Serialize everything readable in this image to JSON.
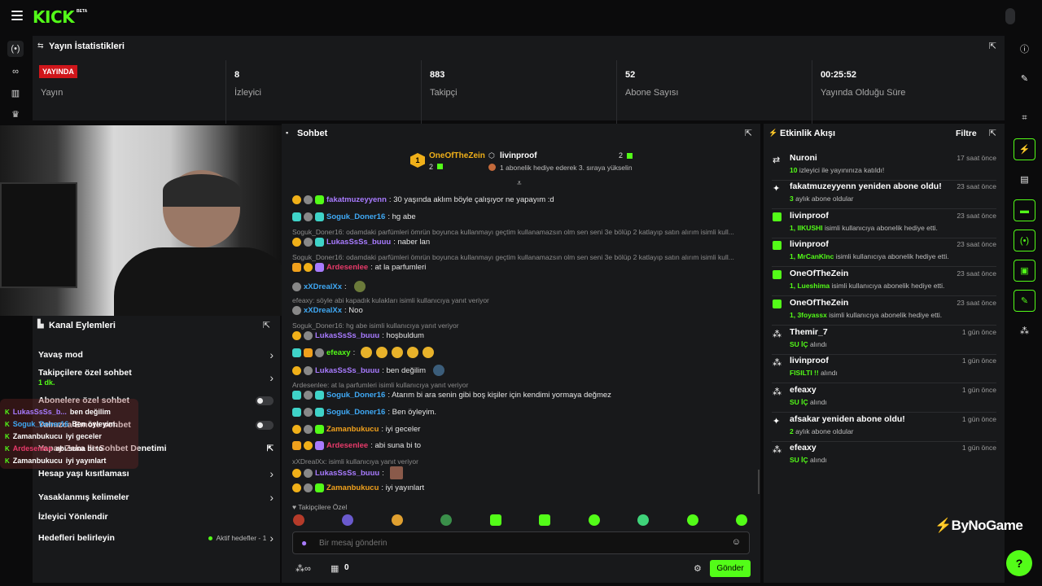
{
  "app": {
    "logo": "KICK",
    "beta": "BETA"
  },
  "colors": {
    "accent": "#53fc18",
    "live": "#d0161b",
    "panel": "#18191b"
  },
  "stats": {
    "title": "Yayın İstatistikleri",
    "live_badge": "YAYINDA",
    "cells": [
      {
        "value": "",
        "label": "Yayın"
      },
      {
        "value": "8",
        "label": "İzleyici"
      },
      {
        "value": "883",
        "label": "Takipçi"
      },
      {
        "value": "52",
        "label": "Abone Sayısı"
      },
      {
        "value": "00:25:52",
        "label": "Yayında Olduğu Süre"
      }
    ]
  },
  "channel": {
    "title": "Kanal Eylemleri",
    "items": [
      {
        "label": "Yavaş mod",
        "sub": ""
      },
      {
        "label": "Takipçilere özel sohbet",
        "sub": "1 dk."
      },
      {
        "label": "Abonelere özel sohbet",
        "sub": ""
      },
      {
        "label": "Yalnızca Emote sohbet",
        "sub": ""
      },
      {
        "label": "Yapay Zeka ile Sohbet Denetimi",
        "sub": ""
      },
      {
        "label": "Hesap yaşı kısıtlaması",
        "sub": ""
      },
      {
        "label": "Yasaklanmış kelimeler",
        "sub": ""
      },
      {
        "label": "İzleyici Yönlendir",
        "sub": ""
      },
      {
        "label": "Hedefleri belirleyin",
        "sub": "Aktif hedefler - 1"
      }
    ]
  },
  "overlay_chat": [
    {
      "user": "LukasSsSs_b...",
      "text": "ben değilim"
    },
    {
      "user": "Soguk_Doner16",
      "text": "Ben öyleyim."
    },
    {
      "user": "Zamanbukucu",
      "text": "iyi geceler"
    },
    {
      "user": "Ardesenlee",
      "text": "abi suna bi to"
    },
    {
      "user": "Zamanbukucu",
      "text": "iyi yayınlart"
    }
  ],
  "chat": {
    "title": "Sohbet",
    "pinned": {
      "user1": "OneOfTheZein",
      "user1_count": "2",
      "user2": "livinproof",
      "user2_count": "2",
      "user2_msg": "1 abonelik hediye ederek 3. sıraya yükselin"
    },
    "messages": [
      {
        "user": "fakatmuzeyyenn",
        "color": "#a87bff",
        "text": ": 30 yaşında aklım böyle çalışıyor ne yapayım :d",
        "reply": ""
      },
      {
        "user": "Soguk_Doner16",
        "color": "#3fa9f5",
        "text": ": hg abe",
        "reply": ""
      },
      {
        "user": "LukasSsSs_buuu",
        "color": "#a87bff",
        "text": ": naber lan",
        "reply": "Soguk_Doner16: odamdaki parfümleri ömrün boyunca kullanmayı geçtim kullanamazsın olm sen seni 3e bölüp 2 katlayıp satın alırım isimli kull..."
      },
      {
        "user": "Ardesenlee",
        "color": "#e83a6a",
        "text": ": at la parfumleri",
        "reply": "Soguk_Doner16: odamdaki parfümleri ömrün boyunca kullanmayı geçtim kullanamazsın olm sen seni 3e bölüp 2 katlayıp satın alırım isimli kull..."
      },
      {
        "user": "xXDrealXx",
        "color": "#3fa9f5",
        "text": ":",
        "reply": ""
      },
      {
        "user": "xXDrealXx",
        "color": "#3fa9f5",
        "text": ": Noo",
        "reply": "efeaxy: söyle abi kapadık kulakları isimli kullanıcıya yanıt veriyor"
      },
      {
        "user": "LukasSsSs_buuu",
        "color": "#a87bff",
        "text": ": hoşbuldum",
        "reply": "Soguk_Doner16: hg abe isimli kullanıcıya yanıt veriyor"
      },
      {
        "user": "efeaxy",
        "color": "#53fc18",
        "text": ":",
        "reply": ""
      },
      {
        "user": "LukasSsSs_buuu",
        "color": "#a87bff",
        "text": ": ben değilim",
        "reply": ""
      },
      {
        "user": "Soguk_Doner16",
        "color": "#3fa9f5",
        "text": ": Atarım bi ara senin gibi boş kişiler için kendimi yormaya değmez",
        "reply": "Ardesenlee: at la parfumleri isimli kullanıcıya yanıt veriyor"
      },
      {
        "user": "Soguk_Doner16",
        "color": "#3fa9f5",
        "text": ": Ben öyleyim.",
        "reply": ""
      },
      {
        "user": "Zamanbukucu",
        "color": "#f0a01c",
        "text": ": iyi geceler",
        "reply": ""
      },
      {
        "user": "Ardesenlee",
        "color": "#e83a6a",
        "text": ": abi suna bi to",
        "reply": ""
      },
      {
        "user": "LukasSsSs_buuu",
        "color": "#a87bff",
        "text": ":",
        "reply": "xXDrealXx:      isimli kullanıcıya yanıt veriyor"
      },
      {
        "user": "Zamanbukucu",
        "color": "#f0a01c",
        "text": ": iyi yayınlart",
        "reply": ""
      }
    ],
    "followers_only": "Takipçilere Özel",
    "input_placeholder": "Bir mesaj gönderin",
    "points": "0",
    "send": "Gönder"
  },
  "events": {
    "title": "Etkinlik Akışı",
    "filter": "Filtre",
    "items": [
      {
        "name": "Nuroni",
        "hl": "10",
        "sub": " izleyici ile yayınınıza katıldı!",
        "time": "17 saat önce"
      },
      {
        "name": "fakatmuzeyyenn yeniden abone oldu!",
        "hl": "3",
        "sub": " aylık abone oldular",
        "time": "23 saat önce"
      },
      {
        "name": "livinproof",
        "hl": "1, lIKUSHI",
        "sub": " isimli kullanıcıya abonelik hediye etti.",
        "time": "23 saat önce"
      },
      {
        "name": "livinproof",
        "hl": "1, MrCanKlnc",
        "sub": " isimli kullanıcıya abonelik hediye etti.",
        "time": "23 saat önce"
      },
      {
        "name": "OneOfTheZein",
        "hl": "1, Lueshima",
        "sub": " isimli kullanıcıya abonelik hediye etti.",
        "time": "23 saat önce"
      },
      {
        "name": "OneOfTheZein",
        "hl": "1, 3foyassx",
        "sub": " isimli kullanıcıya abonelik hediye etti.",
        "time": "23 saat önce"
      },
      {
        "name": "Themir_7",
        "hl": "SU İÇ",
        "sub": " alındı",
        "time": "1 gün önce"
      },
      {
        "name": "livinproof",
        "hl": "FISILTI !!",
        "sub": " alındı",
        "time": "1 gün önce"
      },
      {
        "name": "efeaxy",
        "hl": "SU İÇ",
        "sub": " alındı",
        "time": "1 gün önce"
      },
      {
        "name": "afsakar yeniden abone oldu!",
        "hl": "2",
        "sub": " aylık abone oldular",
        "time": "1 gün önce"
      },
      {
        "name": "efeaxy",
        "hl": "SU İÇ",
        "sub": " alındı",
        "time": "1 gün önce"
      }
    ]
  },
  "watermark": "ByNoGame"
}
